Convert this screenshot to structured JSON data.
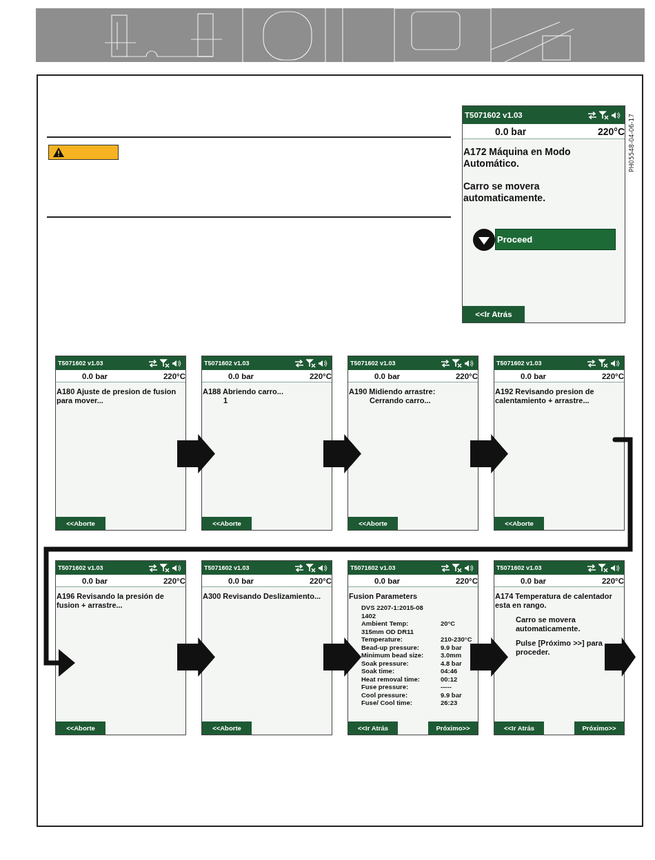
{
  "reference_code": "PH05548-04-06-17",
  "main_screen": {
    "title": "T5071602 v1.03",
    "pressure": "0.0 bar",
    "temperature": "220°C",
    "body": [
      {
        "kind": "text",
        "text": "A172 Máquina en Modo Automático."
      },
      {
        "kind": "paragraph",
        "text": "Carro se movera automaticamente."
      }
    ],
    "option": {
      "label": "Proceed"
    },
    "buttons": [
      {
        "label": "<<Ir Atrás",
        "kind": "back"
      }
    ]
  },
  "sequence": [
    {
      "title": "T5071602 v1.03",
      "pressure": "0.0 bar",
      "temperature": "220°C",
      "body": [
        {
          "kind": "text",
          "text": "A180 Ajuste de presion de fusion para mover..."
        }
      ],
      "buttons": [
        {
          "label": "<<Aborte",
          "kind": "back"
        }
      ]
    },
    {
      "title": "T5071602 v1.03",
      "pressure": "0.0 bar",
      "temperature": "220°C",
      "body": [
        {
          "kind": "text",
          "text": "A188 Abriendo carro..."
        },
        {
          "kind": "indented",
          "text": "1"
        }
      ],
      "buttons": [
        {
          "label": "<<Aborte",
          "kind": "back"
        }
      ]
    },
    {
      "title": "T5071602 v1.03",
      "pressure": "0.0 bar",
      "temperature": "220°C",
      "body": [
        {
          "kind": "text",
          "text": "A190 Midiendo arrastre:"
        },
        {
          "kind": "indented",
          "text": "Cerrando carro..."
        }
      ],
      "buttons": [
        {
          "label": "<<Aborte",
          "kind": "back"
        }
      ]
    },
    {
      "title": "T5071602 v1.03",
      "pressure": "0.0 bar",
      "temperature": "220°C",
      "body": [
        {
          "kind": "text",
          "text": "A192 Revisando presion de calentamiento + arrastre..."
        }
      ],
      "buttons": [
        {
          "label": "<<Aborte",
          "kind": "back"
        }
      ]
    },
    {
      "title": "T5071602 v1.03",
      "pressure": "0.0 bar",
      "temperature": "220°C",
      "body": [
        {
          "kind": "text",
          "text": "A196 Revisando la presión de fusion + arrastre..."
        }
      ],
      "buttons": [
        {
          "label": "<<Aborte",
          "kind": "back"
        }
      ]
    },
    {
      "title": "T5071602 v1.03",
      "pressure": "0.0 bar",
      "temperature": "220°C",
      "body": [
        {
          "kind": "text",
          "text": "A300 Revisando Deslizamiento..."
        }
      ],
      "buttons": [
        {
          "label": "<<Aborte",
          "kind": "back"
        }
      ]
    },
    {
      "title": "T5071602 v1.03",
      "pressure": "0.0 bar",
      "temperature": "220°C",
      "body": [
        {
          "kind": "text",
          "text": "Fusion Parameters"
        },
        {
          "kind": "detail",
          "text": "DVS 2207-1:2015-08"
        },
        {
          "kind": "detail",
          "text": "1402"
        },
        {
          "kind": "param",
          "label": "Ambient Temp:",
          "value": "20°C"
        },
        {
          "kind": "detail",
          "text": "315mm OD DR11"
        },
        {
          "kind": "param",
          "label": "Temperature:",
          "value": "210-230°C"
        },
        {
          "kind": "param",
          "label": "Bead-up pressure:",
          "value": "9.9 bar"
        },
        {
          "kind": "param",
          "label": "Minimum bead size:",
          "value": "3.0mm"
        },
        {
          "kind": "param",
          "label": "Soak pressure:",
          "value": "4.8 bar"
        },
        {
          "kind": "param",
          "label": "Soak time:",
          "value": "04:46"
        },
        {
          "kind": "param",
          "label": "Heat removal time:",
          "value": "00:12"
        },
        {
          "kind": "param",
          "label": "Fuse pressure:",
          "value": "-----"
        },
        {
          "kind": "param",
          "label": "Cool pressure:",
          "value": "9.9 bar"
        },
        {
          "kind": "param",
          "label": "Fuse/ Cool time:",
          "value": "26:23"
        }
      ],
      "buttons": [
        {
          "label": "<<Ir Atrás",
          "kind": "back"
        },
        {
          "label": "Próximo>>",
          "kind": "next"
        }
      ]
    },
    {
      "title": "T5071602 v1.03",
      "pressure": "0.0 bar",
      "temperature": "220°C",
      "body": [
        {
          "kind": "text",
          "text": "A174 Temperatura de calentador esta en rango."
        },
        {
          "kind": "indented-paragraph",
          "text": "Carro se movera automaticamente."
        },
        {
          "kind": "indented-paragraph",
          "text": "Pulse [Próximo >>] para proceder."
        }
      ],
      "buttons": [
        {
          "label": "<<Ir Atrás",
          "kind": "back"
        },
        {
          "label": "Próximo>>",
          "kind": "next"
        }
      ]
    }
  ]
}
